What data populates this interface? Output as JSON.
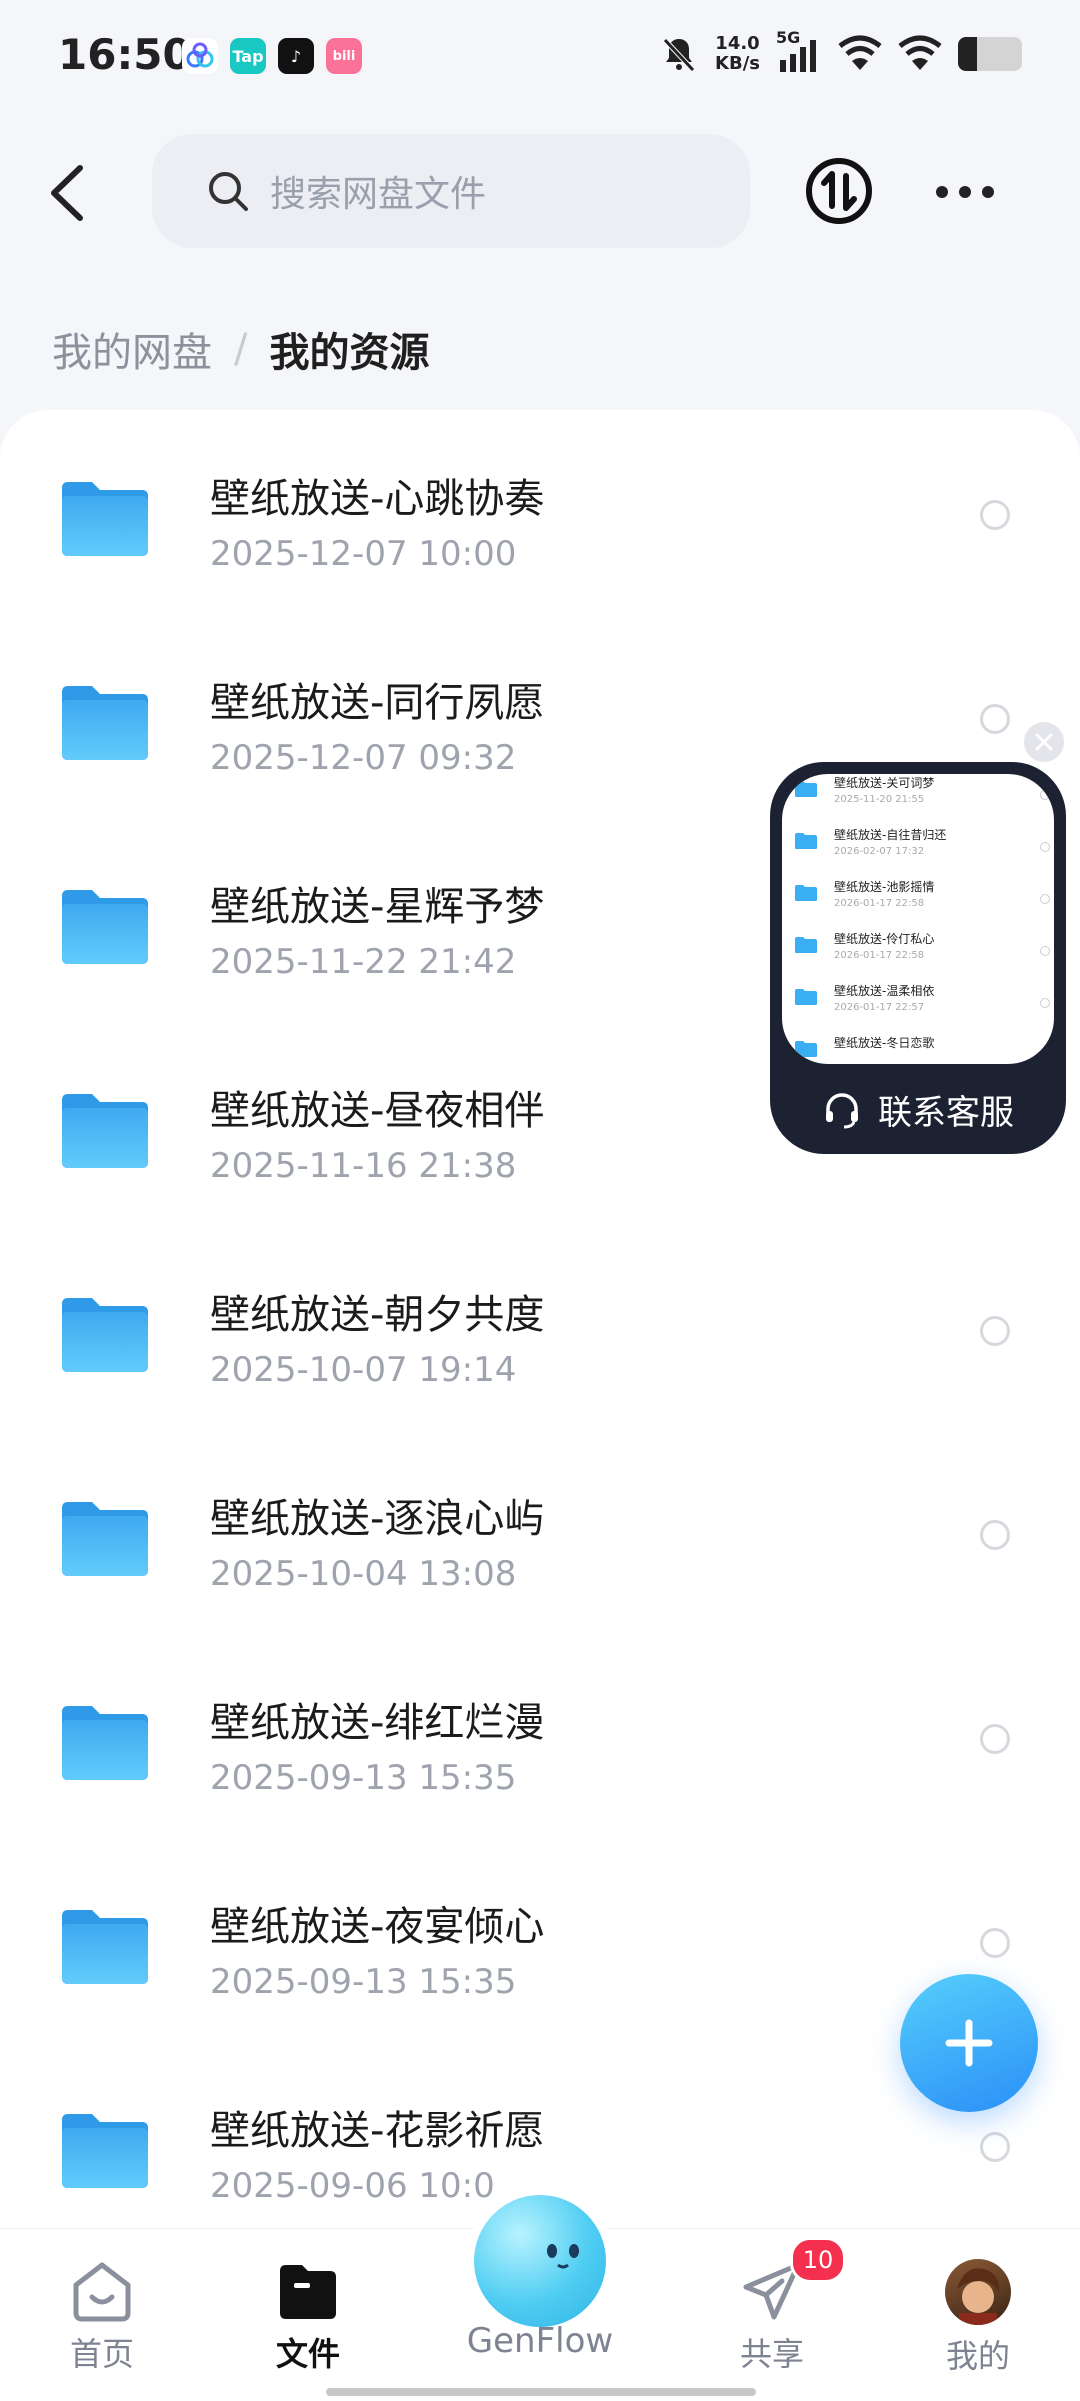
{
  "status_bar": {
    "time": "16:50",
    "net_speed_value": "14.0",
    "net_speed_unit": "KB/s",
    "signal_label": "5G",
    "battery_level": 0.3,
    "app_icons": [
      {
        "name": "cloud-app-icon",
        "text": "",
        "color": "#3a7bff"
      },
      {
        "name": "taptap-icon",
        "text": "Tap",
        "color": "#19c8c2"
      },
      {
        "name": "tiktok-icon",
        "text": "♪",
        "color": "#111111"
      },
      {
        "name": "bilibili-icon",
        "text": "bili",
        "color": "#fb7299"
      }
    ]
  },
  "header": {
    "search_placeholder": "搜索网盘文件"
  },
  "breadcrumb": {
    "root": "我的网盘",
    "separator": "/",
    "current": "我的资源"
  },
  "files": [
    {
      "name": "壁纸放送-心跳协奏",
      "date": "2025-12-07  10:00"
    },
    {
      "name": "壁纸放送-同行夙愿",
      "date": "2025-12-07  09:32"
    },
    {
      "name": "壁纸放送-星辉予梦",
      "date": "2025-11-22  21:42"
    },
    {
      "name": "壁纸放送-昼夜相伴",
      "date": "2025-11-16  21:38"
    },
    {
      "name": "壁纸放送-朝夕共度",
      "date": "2025-10-07  19:14"
    },
    {
      "name": "壁纸放送-逐浪心屿",
      "date": "2025-10-04  13:08"
    },
    {
      "name": "壁纸放送-绯红烂漫",
      "date": "2025-09-13  15:35"
    },
    {
      "name": "壁纸放送-夜宴倾心",
      "date": "2025-09-13  15:35"
    },
    {
      "name": "壁纸放送-花影祈愿",
      "date": "2025-09-06  10:0"
    }
  ],
  "float_window": {
    "label": "联系客服",
    "mini_files": [
      {
        "name": "壁纸放送-关可词梦",
        "date": "2025-11-20  21:55"
      },
      {
        "name": "壁纸放送-自往昔归还",
        "date": "2026-02-07  17:32"
      },
      {
        "name": "壁纸放送-池影摇情",
        "date": "2026-01-17  22:58"
      },
      {
        "name": "壁纸放送-伶仃私心",
        "date": "2026-01-17  22:58"
      },
      {
        "name": "壁纸放送-温柔相依",
        "date": "2026-01-17  22:57"
      },
      {
        "name": "壁纸放送-冬日恋歌",
        "date": ""
      }
    ]
  },
  "tabs": [
    {
      "label": "首页",
      "icon": "home-icon",
      "active": false
    },
    {
      "label": "文件",
      "icon": "folder-icon",
      "active": true
    },
    {
      "label": "GenFlow",
      "icon": "genflow-mascot-icon",
      "active": false
    },
    {
      "label": "共享",
      "icon": "send-icon",
      "active": false,
      "badge": "10"
    },
    {
      "label": "我的",
      "icon": "avatar",
      "active": false
    }
  ],
  "colors": {
    "accent": "#2a8ff7",
    "folder": "#4cb6f5",
    "badge": "#f5304f"
  }
}
